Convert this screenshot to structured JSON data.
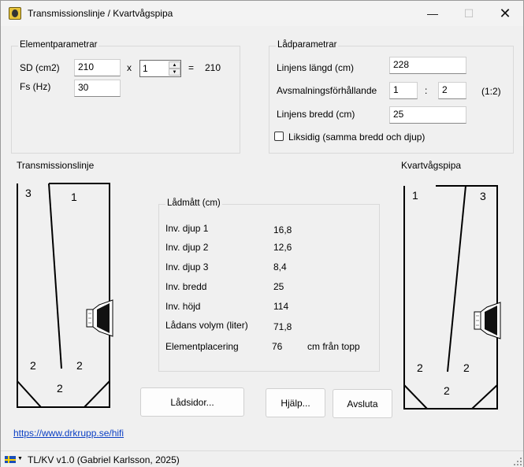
{
  "window": {
    "title": "Transmissionslinje / Kvartvågspipa"
  },
  "element": {
    "legend": "Elementparametrar",
    "sd_label": "SD (cm2)",
    "sd_value": "210",
    "times": "x",
    "count_value": "1",
    "equals": "=",
    "total": "210",
    "fs_label": "Fs (Hz)",
    "fs_value": "30"
  },
  "box_params": {
    "legend": "Lådparametrar",
    "length_label": "Linjens längd (cm)",
    "length_value": "228",
    "taper_label": "Avsmalningsförhållande",
    "taper_a": "1",
    "colon": ":",
    "taper_b": "2",
    "taper_display": "(1:2)",
    "width_label": "Linjens bredd (cm)",
    "width_value": "25",
    "equal_sides_label": "Liksidig (samma bredd och djup)",
    "equal_sides_checked": false
  },
  "tl_diagram": {
    "title": "Transmissionslinje",
    "num_3": "3",
    "num_1": "1",
    "num_2a": "2",
    "num_2b": "2",
    "num_2c": "2"
  },
  "qw_diagram": {
    "title": "Kvartvågspipa",
    "num_1": "1",
    "num_3": "3",
    "num_2a": "2",
    "num_2b": "2",
    "num_2c": "2"
  },
  "dimensions": {
    "legend": "Lådmått (cm)",
    "rows": [
      {
        "label": "Inv. djup 1",
        "value": "16,8"
      },
      {
        "label": "Inv. djup 2",
        "value": "12,6"
      },
      {
        "label": "Inv. djup 3",
        "value": "8,4"
      },
      {
        "label": "Inv. bredd",
        "value": "25"
      },
      {
        "label": "Inv. höjd",
        "value": "114"
      },
      {
        "label": "Lådans volym (liter)",
        "value": "71,8"
      },
      {
        "label": "Elementplacering",
        "value": "76",
        "unit": "cm från topp"
      }
    ]
  },
  "buttons": {
    "sides": "Lådsidor...",
    "help": "Hjälp...",
    "quit": "Avsluta"
  },
  "link": "https://www.drkrupp.se/hifi",
  "status": "TL/KV v1.0  (Gabriel Karlsson, 2025)"
}
